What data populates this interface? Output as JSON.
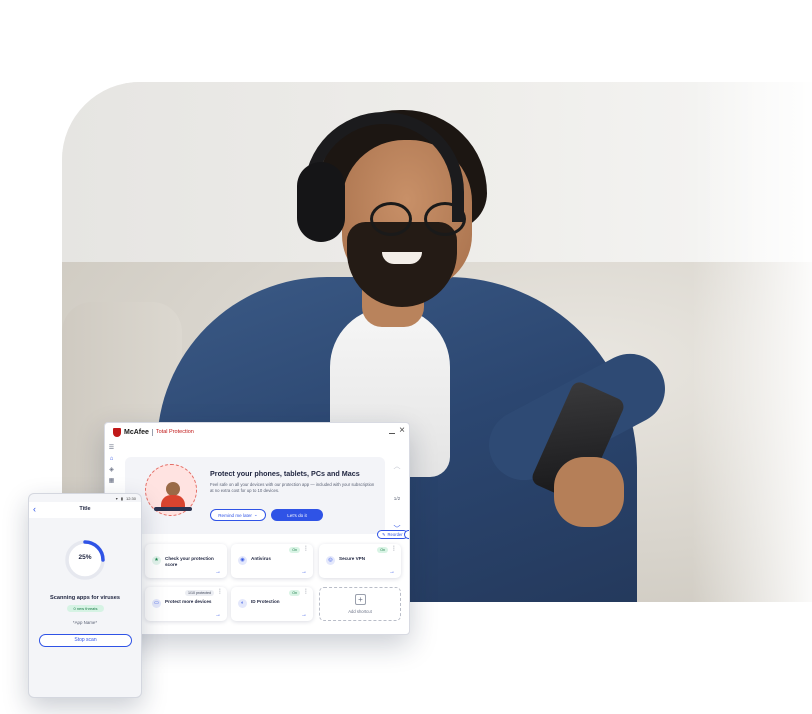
{
  "colors": {
    "accent": "#2f53e6",
    "brand_red": "#c01818",
    "success": "#1a7b47"
  },
  "window": {
    "brand": "McAfee",
    "product": "Total Protection",
    "icons": [
      "minimize-icon",
      "close-icon"
    ],
    "rail_icons": [
      "menu-icon",
      "home-icon",
      "shield-icon",
      "grid-icon"
    ]
  },
  "promo": {
    "title": "Protect your phones, tablets, PCs and Macs",
    "description": "Feel safe on all your devices with our protection app — included with your subscription at no extra cost for up to 10 devices.",
    "remind_label": "Remind me later",
    "cta_label": "Let's do it",
    "pager": "1/2"
  },
  "reorder_label": "Reorder",
  "tiles": [
    {
      "label": "Check your protection score",
      "badge": ""
    },
    {
      "label": "Antivirus",
      "badge": "On"
    },
    {
      "label": "Secure VPN",
      "badge": "On"
    },
    {
      "label": "Protect more devices",
      "badge": "1/10 protected"
    },
    {
      "label": "ID Protection",
      "badge": "On"
    }
  ],
  "add_shortcut_label": "Add shortcut",
  "phone": {
    "status_time": "12:30",
    "title": "Title",
    "progress_label": "25%",
    "progress": 0.25,
    "scanning": "Scanning apps for viruses",
    "threats": "0 new threats",
    "app_name": "*App Name*",
    "stop_label": "Stop scan"
  }
}
